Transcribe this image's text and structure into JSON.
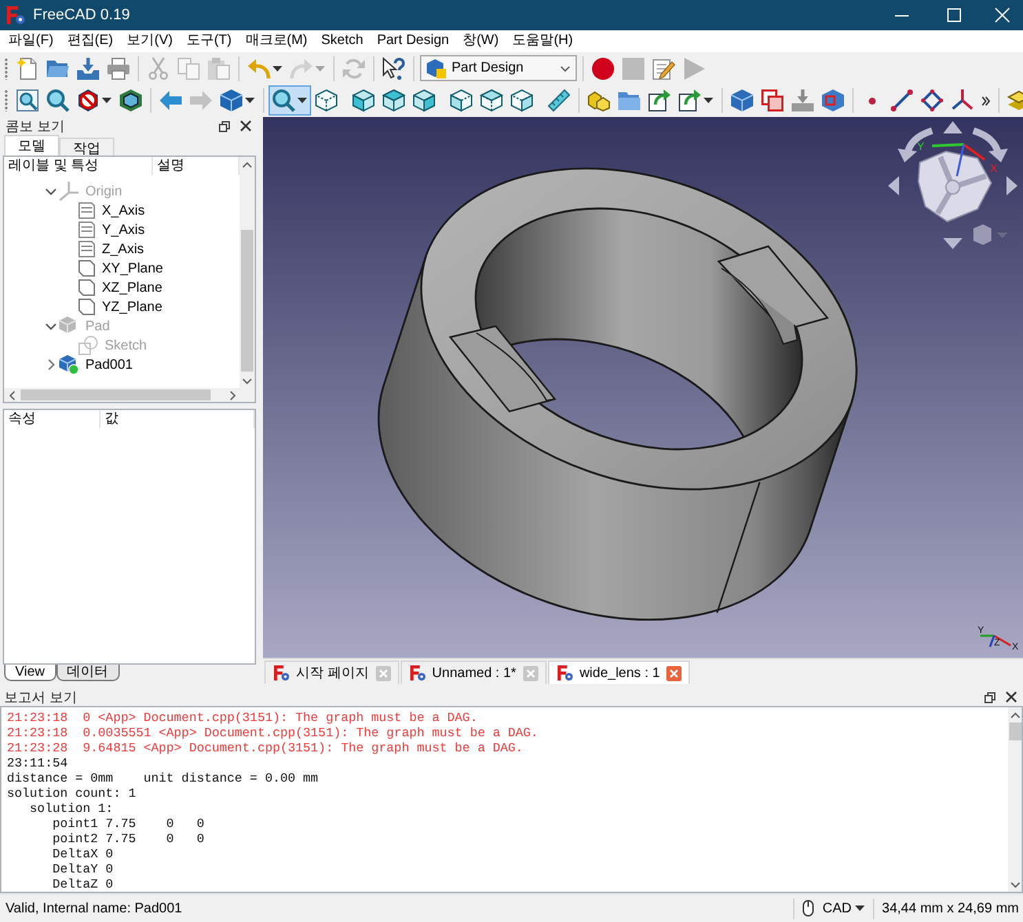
{
  "window": {
    "title": "FreeCAD 0.19"
  },
  "menu": [
    "파일(F)",
    "편집(E)",
    "보기(V)",
    "도구(T)",
    "매크로(M)",
    "Sketch",
    "Part Design",
    "창(W)",
    "도움말(H)"
  ],
  "toolbars": [
    {
      "buttons": [
        {
          "kind": "button",
          "disabled": false,
          "active": false
        },
        {
          "kind": "button",
          "disabled": false,
          "active": false
        },
        {
          "kind": "button",
          "disabled": false,
          "active": false
        },
        {
          "kind": "button",
          "disabled": false,
          "active": false
        },
        {
          "kind": "button",
          "disabled": true,
          "active": false
        },
        {
          "kind": "button",
          "disabled": true,
          "active": false
        },
        {
          "kind": "button",
          "disabled": true,
          "active": false
        },
        {
          "kind": "dropdown",
          "disabled": false,
          "active": false
        },
        {
          "kind": "dropdown",
          "disabled": true,
          "active": false
        },
        {
          "kind": "button",
          "disabled": true,
          "active": false
        },
        {
          "kind": "button",
          "disabled": false,
          "active": false
        },
        {
          "kind": "combo",
          "label": "Part Design",
          "disabled": false,
          "active": false
        },
        {
          "kind": "button",
          "disabled": false,
          "active": false
        },
        {
          "kind": "button",
          "disabled": true,
          "active": false
        },
        {
          "kind": "button",
          "disabled": false,
          "active": false
        },
        {
          "kind": "button",
          "disabled": true,
          "active": false
        }
      ]
    },
    {
      "buttons": [
        {
          "kind": "button",
          "disabled": false,
          "active": false
        },
        {
          "kind": "button",
          "disabled": false,
          "active": false
        },
        {
          "kind": "dropdown",
          "disabled": false,
          "active": false
        },
        {
          "kind": "button",
          "disabled": false,
          "active": false
        },
        {
          "kind": "button",
          "disabled": false,
          "active": false
        },
        {
          "kind": "button",
          "disabled": true,
          "active": false
        },
        {
          "kind": "dropdown",
          "disabled": false,
          "active": false
        },
        {
          "kind": "dropdown",
          "disabled": false,
          "active": true
        },
        {
          "kind": "button",
          "disabled": false,
          "active": false
        },
        {
          "kind": "button",
          "disabled": false,
          "active": false
        },
        {
          "kind": "button",
          "disabled": false,
          "active": false
        },
        {
          "kind": "button",
          "disabled": false,
          "active": false
        },
        {
          "kind": "button",
          "disabled": false,
          "active": false
        },
        {
          "kind": "button",
          "disabled": false,
          "active": false
        },
        {
          "kind": "button",
          "disabled": false,
          "active": false
        },
        {
          "kind": "button",
          "disabled": false,
          "active": false
        },
        {
          "kind": "button",
          "disabled": false,
          "active": false
        },
        {
          "kind": "button",
          "disabled": false,
          "active": false
        },
        {
          "kind": "button",
          "disabled": false,
          "active": false
        },
        {
          "kind": "dropdown",
          "disabled": false,
          "active": false
        },
        {
          "kind": "button",
          "disabled": false,
          "active": false
        },
        {
          "kind": "button",
          "disabled": false,
          "active": false
        },
        {
          "kind": "button",
          "disabled": false,
          "active": false
        },
        {
          "kind": "button",
          "disabled": false,
          "active": false
        },
        {
          "kind": "button",
          "disabled": false,
          "active": false
        },
        {
          "kind": "button",
          "disabled": false,
          "active": false
        },
        {
          "kind": "button",
          "disabled": false,
          "active": false
        },
        {
          "kind": "button",
          "disabled": false,
          "active": false
        },
        {
          "kind": "button",
          "disabled": false,
          "active": false
        }
      ]
    }
  ],
  "combo_view": {
    "title": "콤보 보기",
    "tabs": [
      {
        "label": "모델",
        "selected": true
      },
      {
        "label": "작업",
        "selected": false
      }
    ],
    "tree": {
      "columns": [
        "레이블 및 특성",
        "설명"
      ],
      "items": [
        {
          "label": "Origin",
          "kind": "origin",
          "hidden": true,
          "expanded": true,
          "children": [
            {
              "label": "X_Axis",
              "kind": "axis",
              "hidden": false
            },
            {
              "label": "Y_Axis",
              "kind": "axis",
              "hidden": false
            },
            {
              "label": "Z_Axis",
              "kind": "axis",
              "hidden": false
            },
            {
              "label": "XY_Plane",
              "kind": "plane",
              "hidden": false
            },
            {
              "label": "XZ_Plane",
              "kind": "plane",
              "hidden": false
            },
            {
              "label": "YZ_Plane",
              "kind": "plane",
              "hidden": false
            }
          ]
        },
        {
          "label": "Pad",
          "kind": "feature",
          "hidden": true,
          "expanded": true,
          "tip": false,
          "children": [
            {
              "label": "Sketch",
              "kind": "sketch",
              "hidden": true
            }
          ]
        },
        {
          "label": "Pad001",
          "kind": "feature",
          "hidden": false,
          "expanded": false,
          "tip": true
        }
      ]
    },
    "properties": {
      "columns": [
        "속성",
        "값"
      ]
    },
    "view_tabs": [
      {
        "label": "View",
        "selected": true
      },
      {
        "label": "데이터",
        "selected": false
      }
    ]
  },
  "viewport": {
    "navigation_cube": {
      "axis_labels": [
        "Y",
        "X"
      ]
    },
    "axis_triad": {
      "labels": [
        "Y",
        "Z",
        "X"
      ]
    }
  },
  "document_tabs": [
    {
      "label": "시작 페이지",
      "selected": false
    },
    {
      "label": "Unnamed : 1*",
      "selected": false
    },
    {
      "label": "wide_lens : 1",
      "selected": true
    }
  ],
  "report_view": {
    "title": "보고서 보기",
    "lines": [
      {
        "kind": "error",
        "text": "21:23:18  0 <App> Document.cpp(3151): The graph must be a DAG."
      },
      {
        "kind": "error",
        "text": "21:23:18  0.0035551 <App> Document.cpp(3151): The graph must be a DAG."
      },
      {
        "kind": "error",
        "text": "21:23:28  9.64815 <App> Document.cpp(3151): The graph must be a DAG."
      },
      {
        "kind": "log",
        "text": "23:11:54"
      },
      {
        "kind": "log",
        "text": "distance = 0mm    unit distance = 0.00 mm"
      },
      {
        "kind": "log",
        "text": "solution count: 1"
      },
      {
        "kind": "log",
        "text": "   solution 1:"
      },
      {
        "kind": "log",
        "text": "      point1 7.75    0   0"
      },
      {
        "kind": "log",
        "text": "      point2 7.75    0   0"
      },
      {
        "kind": "log",
        "text": "      DeltaX 0"
      },
      {
        "kind": "log",
        "text": "      DeltaY 0"
      },
      {
        "kind": "log",
        "text": "      DeltaZ 0"
      }
    ]
  },
  "status_bar": {
    "message": "Valid, Internal name: Pad001",
    "navigation_style": "CAD",
    "dimensions": "34,44 mm x 24,69 mm"
  }
}
